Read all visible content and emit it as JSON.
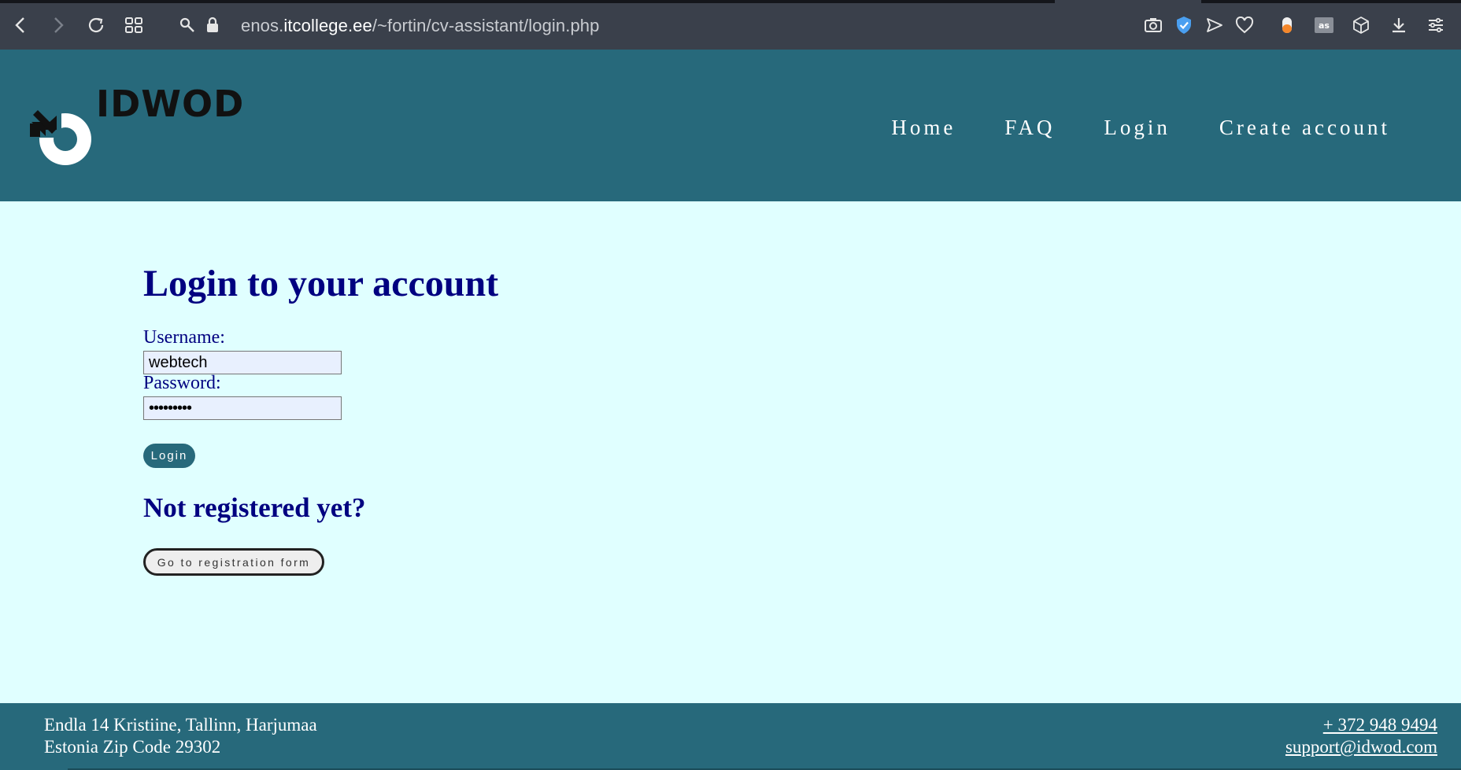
{
  "browser": {
    "url_prefix": "enos.",
    "url_domain": "itcollege.ee",
    "url_path": "/~fortin/cv-assistant/login.php"
  },
  "header": {
    "logo_text": "IDWOD",
    "nav": [
      {
        "label": "Home"
      },
      {
        "label": "FAQ"
      },
      {
        "label": "Login"
      },
      {
        "label": "Create account"
      }
    ]
  },
  "login": {
    "title": "Login to your account",
    "username_label": "Username:",
    "username_value": "webtech",
    "password_label": "Password:",
    "password_value": "•••••••••",
    "submit_label": "Login"
  },
  "register": {
    "heading": "Not registered yet?",
    "button_label": "Go to registration form"
  },
  "footer": {
    "address_line1": "Endla 14 Kristiine, Tallinn, Harjumaa",
    "address_line2": "Estonia Zip Code 29302",
    "phone": "+ 372 948 9494",
    "email": "support@idwod.com"
  },
  "colors": {
    "header_bg": "#27697b",
    "page_bg": "#e0ffff",
    "heading": "#000080"
  }
}
